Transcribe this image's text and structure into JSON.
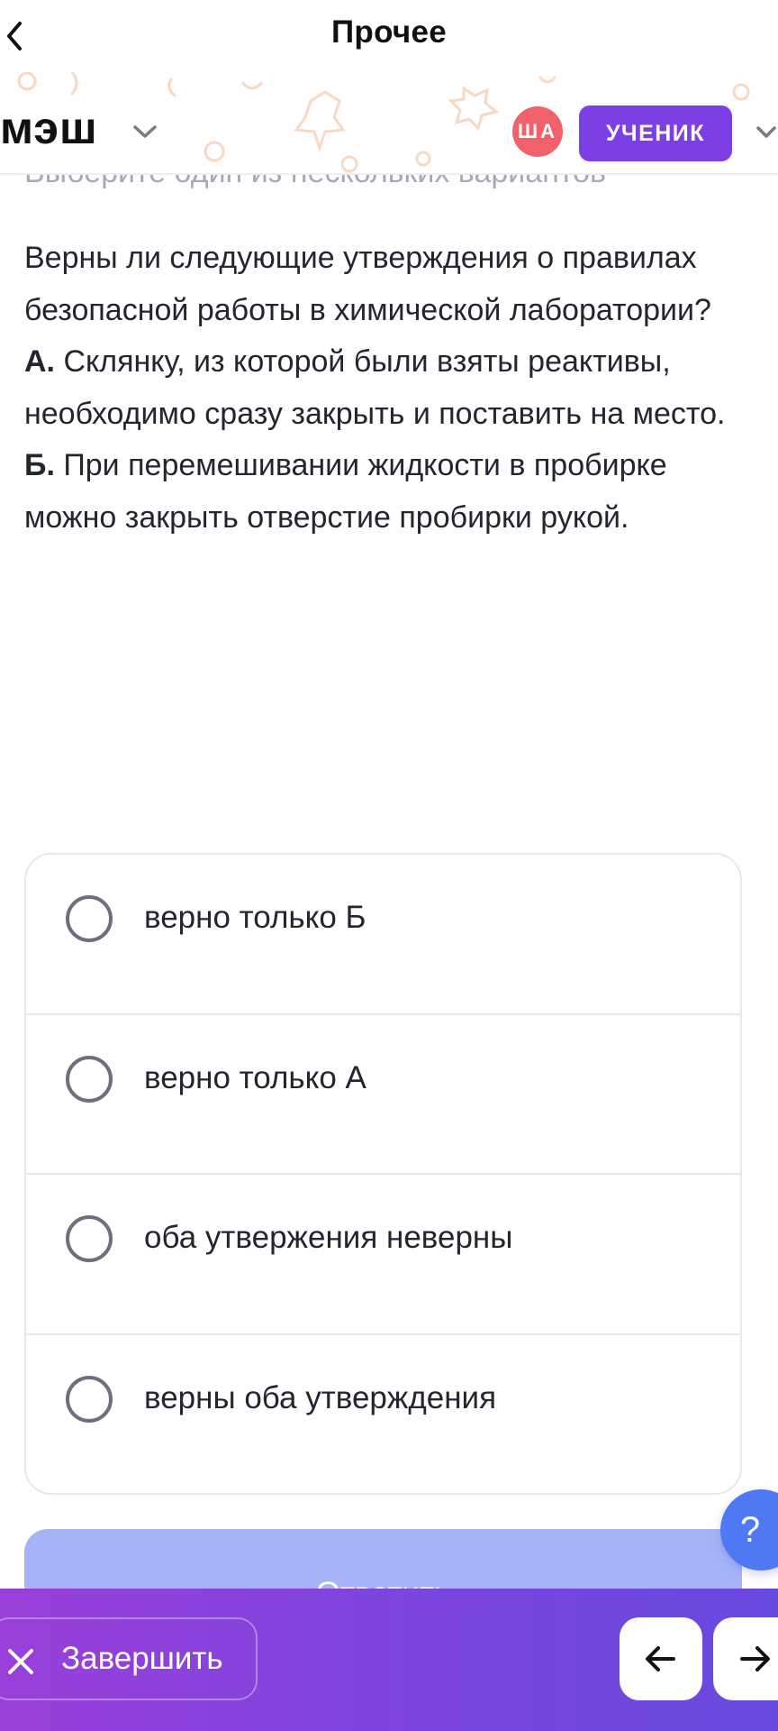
{
  "topnav": {
    "title": "Прочее"
  },
  "header": {
    "logo": "мэш",
    "avatar_initials": "ША",
    "role_label": "УЧЕНИК"
  },
  "task": {
    "subtitle": "Выберите один из нескольких вариантов",
    "question_intro": "Верны ли следующие утверждения о правилах безопасной работы в химической лаборатории?",
    "statement_a_marker": "А.",
    "statement_a_text": " Склянку, из которой были взяты реактивы, необходимо сразу закрыть и поставить на место.",
    "statement_b_marker": "Б.",
    "statement_b_text": " При перемешивании жидкости в пробирке можно закрыть отверстие пробирки рукой."
  },
  "options": [
    {
      "label": "верно только Б",
      "selected": false
    },
    {
      "label": "верно только А",
      "selected": false
    },
    {
      "label": "оба утвержения неверны",
      "selected": false
    },
    {
      "label": "верны оба утверждения",
      "selected": false
    }
  ],
  "help": {
    "label": "?"
  },
  "submit": {
    "label": "Ответить"
  },
  "bottombar": {
    "finish_label": "Завершить"
  },
  "colors": {
    "accent": "#7b3fe4",
    "avatar": "#f0616b",
    "submit_disabled": "#a6b4f7",
    "help": "#4f79f4"
  }
}
